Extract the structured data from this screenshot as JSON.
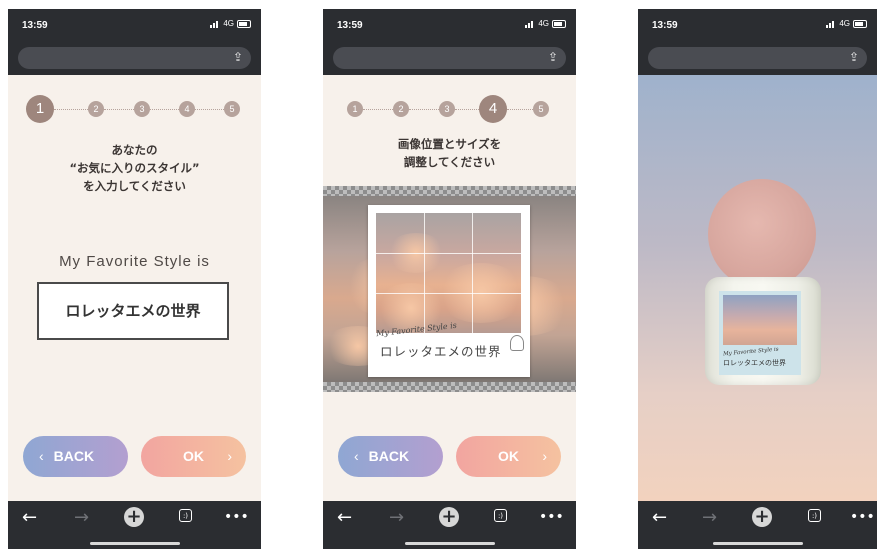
{
  "status": {
    "time": "13:59",
    "network": "4G"
  },
  "buttons": {
    "back": "BACK",
    "ok": "OK"
  },
  "steps": [
    "1",
    "2",
    "3",
    "4",
    "5"
  ],
  "screen1": {
    "active_step": 1,
    "instruction": [
      "あなたの",
      "“お気に入りのスタイル”",
      "を入力してください"
    ],
    "title": "My Favorite Style is",
    "name_value": "ロレッタエメの世界"
  },
  "screen2": {
    "active_step": 4,
    "instruction": [
      "画像位置とサイズを",
      "調整してください"
    ],
    "card_script": "My Favorite Style is",
    "card_name": "ロレッタエメの世界"
  },
  "screen3": {
    "label_script": "My Favorite Style is",
    "label_name": "ロレッタエメの世界"
  },
  "icons": [
    "share-icon",
    "back-arrow-icon",
    "forward-arrow-icon",
    "new-tab-icon",
    "tabs-icon",
    "more-icon"
  ]
}
